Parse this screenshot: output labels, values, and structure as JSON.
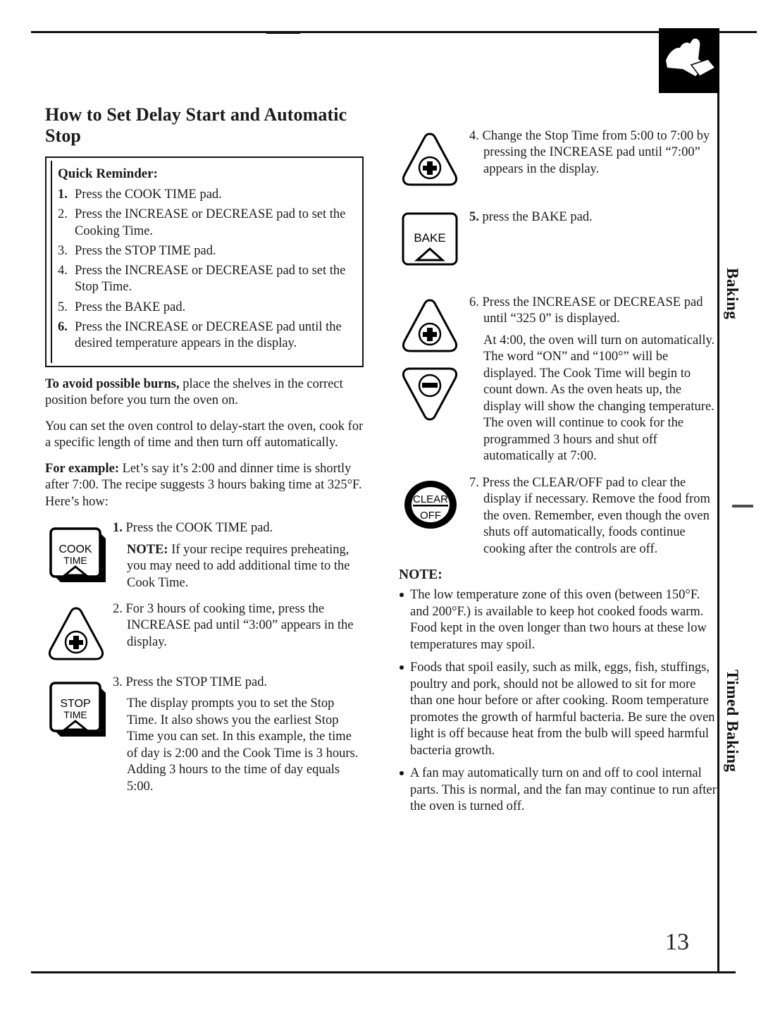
{
  "page": {
    "number": "13",
    "heading": "How to Set Delay Start and Automatic Stop",
    "margin_tabs": {
      "upper": "Baking",
      "lower": "Timed Baking"
    },
    "corner_icon": "hand-pressing-pad-icon"
  },
  "quick_reminder": {
    "title": "Quick Reminder:",
    "steps": [
      {
        "num": "1.",
        "text": "Press the COOK TIME pad.",
        "bold_num": true
      },
      {
        "num": "2.",
        "text": "Press the INCREASE or DECREASE pad to set the Cooking Time.",
        "bold_num": false
      },
      {
        "num": "3.",
        "text": "Press the STOP TIME pad.",
        "bold_num": false
      },
      {
        "num": "4.",
        "text": "Press the INCREASE or DECREASE pad to set the Stop Time.",
        "bold_num": false
      },
      {
        "num": "5.",
        "text": "Press the BAKE pad.",
        "bold_num": false
      },
      {
        "num": "6.",
        "text": "Press the INCREASE or DECREASE pad until the desired temperature appears in the display.",
        "bold_num": true
      }
    ]
  },
  "intro": {
    "burns_lead": "To avoid possible burns,",
    "burns_rest": " place the shelves in the correct position before you turn the oven on.",
    "delay_paragraph": "You can set the oven control to delay-start the oven, cook for a specific length of time and then turn off automatically.",
    "example_lead": "For example:",
    "example_rest": " Let’s say it’s 2:00 and dinner time is shortly after 7:00. The recipe suggests 3 hours baking time at 325°F. Here’s how:"
  },
  "left_steps": [
    {
      "pad": "cook-time-pad",
      "pad_line1": "COOK",
      "pad_line2": "TIME",
      "marker": "1.",
      "text": "Press the COOK TIME pad.",
      "note_lead": "NOTE:",
      "note_rest": " If your recipe requires preheating, you may need to add additional time to the Cook Time."
    },
    {
      "pad": "increase-pad",
      "pad_line1": "",
      "pad_line2": "",
      "marker": "2.",
      "text": "For 3 hours of cooking time, press the INCREASE pad until “3:00” appears in the display.",
      "note_lead": "",
      "note_rest": ""
    },
    {
      "pad": "stop-time-pad",
      "pad_line1": "STOP",
      "pad_line2": "TIME",
      "marker": "3.",
      "text": "Press the STOP TIME pad.",
      "note_lead": "",
      "note_rest": "The display prompts you to set the Stop Time. It also shows you the earliest Stop Time you can set. In this example, the time of day is 2:00 and the Cook Time is 3 hours. Adding 3 hours to the time of day equals 5:00."
    }
  ],
  "right_steps": [
    {
      "pad": "increase-pad",
      "marker": "4.",
      "text": "Change the Stop Time from 5:00 to 7:00 by pressing the INCREASE pad until “7:00” appears in the display.",
      "extra": ""
    },
    {
      "pad": "bake-pad",
      "pad_label": "BAKE",
      "marker": "5.",
      "text": "press the BAKE pad.",
      "extra": ""
    },
    {
      "pad": "increase-decrease-pads",
      "marker": "6.",
      "text": "Press the INCREASE or DECREASE pad until “325 0” is displayed.",
      "extra": "At 4:00, the oven will turn on automatically. The word “ON” and “100°” will be displayed. The Cook Time will begin to count down. As the oven heats up, the display will show the changing temperature. The oven will continue to cook for the programmed 3 hours and shut off automatically at 7:00."
    },
    {
      "pad": "clear-off-pad",
      "pad_line1": "CLEAR",
      "pad_line2": "OFF",
      "marker": "7.",
      "text": "Press the CLEAR/OFF pad to clear the display if necessary. Remove the food from the oven. Remember, even though the oven shuts off automatically, foods continue cooking after the controls are off.",
      "extra": ""
    }
  ],
  "note_section": {
    "title": "NOTE:",
    "bullets": [
      "The low temperature zone of this oven (between 150°F. and 200°F.) is available to keep hot cooked foods warm. Food kept in the oven longer than two hours at these low temperatures may spoil.",
      "Foods that spoil easily, such as milk, eggs, fish, stuffings, poultry and pork, should not be allowed to sit for more than one hour before or after cooking. Room temperature promotes the growth of harmful bacteria. Be sure the oven light is off because heat from the bulb will speed harmful bacteria growth.",
      "A fan may automatically turn on and off to cool internal parts. This is normal, and the fan may continue to run after the oven is turned off."
    ]
  }
}
